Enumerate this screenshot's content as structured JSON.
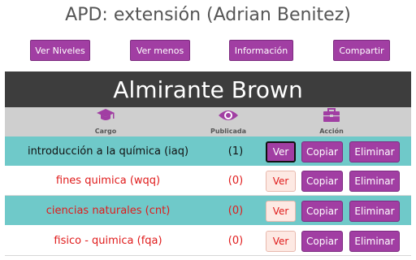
{
  "page": {
    "title": "APD: extensión (Adrian Benitez)"
  },
  "toolbar": {
    "ver_niveles": "Ver Niveles",
    "ver_menos": "Ver menos",
    "informacion": "Información",
    "compartir": "Compartir"
  },
  "banner": {
    "title": "Almirante Brown"
  },
  "table": {
    "columns": [
      {
        "label": "Cargo",
        "icon": "graduation-cap-icon"
      },
      {
        "label": "Publicada",
        "icon": "eye-icon"
      },
      {
        "label": "Acción",
        "icon": "briefcase-icon"
      }
    ],
    "rows": [
      {
        "name": "introducción a la química (iaq)",
        "published": "(1)",
        "ver": "Ver",
        "copiar": "Copiar",
        "eliminar": "Eliminar"
      },
      {
        "name": "fines quimica (wqq)",
        "published": "(0)",
        "ver": "Ver",
        "copiar": "Copiar",
        "eliminar": "Eliminar"
      },
      {
        "name": "ciencias naturales (cnt)",
        "published": "(0)",
        "ver": "Ver",
        "copiar": "Copiar",
        "eliminar": "Eliminar"
      },
      {
        "name": "fisico - quimica (fqa)",
        "published": "(0)",
        "ver": "Ver",
        "copiar": "Copiar",
        "eliminar": "Eliminar"
      }
    ]
  },
  "colors": {
    "accent": "#a13ea3",
    "banner": "#3d3d3d",
    "teal_row": "#6fc9c9",
    "unpublished_text": "#e01b1b"
  }
}
